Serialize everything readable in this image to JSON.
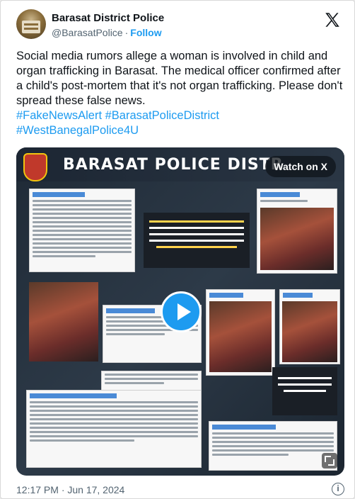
{
  "account": {
    "name": "Barasat District Police",
    "handle": "@BarasatPolice",
    "separator": "·",
    "follow_label": "Follow"
  },
  "tweet": {
    "text": "Social media rumors allege a woman is involved in child and organ trafficking in Barasat. The medical officer confirmed after a child's post-mortem that it's not organ trafficking. Please don't spread these false news.",
    "hashtags": "#FakeNewsAlert #BarasatPoliceDistrict #WestBanegalPolice4U",
    "timestamp": "12:17 PM · Jun 17, 2024"
  },
  "media": {
    "banner_text": "BARASAT POLICE DISTR",
    "watch_label": "Watch on X",
    "accent": "#1d9bf0"
  },
  "icons": {
    "platform_logo": "x-logo-icon",
    "play": "play-icon",
    "info": "info-icon",
    "expand": "expand-icon"
  },
  "info_glyph": "i"
}
